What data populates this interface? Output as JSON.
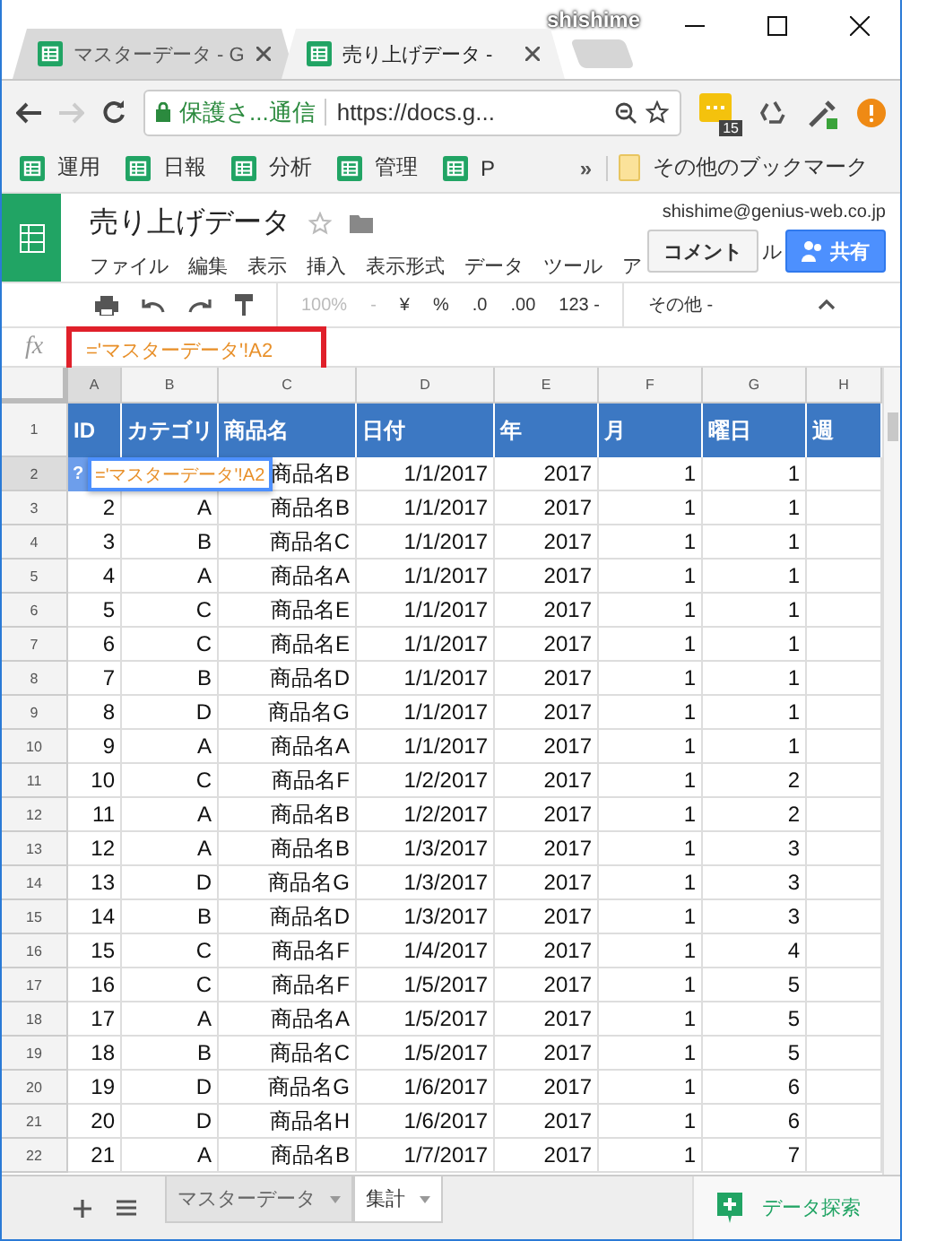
{
  "browser": {
    "profile": "shishime",
    "tabs": [
      {
        "title": "マスターデータ - G",
        "selected": false
      },
      {
        "title": "売り上げデータ -",
        "selected": true
      }
    ],
    "address": {
      "security": "保護さ...通信",
      "url": "https://docs.g..."
    },
    "extension_badge": "15",
    "bookmarks": [
      {
        "label": "運用",
        "kind": "sheet"
      },
      {
        "label": "日報",
        "kind": "sheet"
      },
      {
        "label": "分析",
        "kind": "sheet"
      },
      {
        "label": "管理",
        "kind": "sheet"
      },
      {
        "label": "P",
        "kind": "sheet"
      }
    ],
    "bookmarks_more": "»",
    "other_bookmarks": "その他のブックマーク"
  },
  "doc": {
    "title": "売り上げデータ",
    "account": "shishime@genius-web.co.jp",
    "menu": [
      "ファイル",
      "編集",
      "表示",
      "挿入",
      "表示形式",
      "データ",
      "ツール",
      "ア"
    ],
    "menu_tail": "ル",
    "comment_button": "コメント",
    "share_button": "共有"
  },
  "toolbar": {
    "zoom": "100%",
    "zoom_caret": "-",
    "items": [
      "¥",
      "%",
      ".0",
      ".00",
      "123 -"
    ],
    "more": "その他 -"
  },
  "formula_bar": {
    "label": "fx",
    "formula": "='マスターデータ'!A2"
  },
  "sheet": {
    "columns": [
      {
        "letter": "A",
        "selected": true
      },
      {
        "letter": "B",
        "selected": false
      },
      {
        "letter": "C",
        "selected": false
      },
      {
        "letter": "D",
        "selected": false
      },
      {
        "letter": "E",
        "selected": false
      },
      {
        "letter": "F",
        "selected": false
      },
      {
        "letter": "G",
        "selected": false
      },
      {
        "letter": "H",
        "selected": false
      }
    ],
    "header": {
      "number": "1",
      "cells": [
        "ID",
        "カテゴリ",
        "商品名",
        "日付",
        "年",
        "月",
        "曜日",
        "週"
      ]
    },
    "editor": {
      "hint": "?",
      "text": "='マスターデータ'!A2"
    },
    "rows": [
      {
        "number": "2",
        "selected": true,
        "product": "商品名B",
        "date": "1/1/2017",
        "year": "2017",
        "month": "1",
        "weekday": "1"
      },
      {
        "number": "3",
        "selected": false,
        "id": "2",
        "category": "A",
        "product": "商品名B",
        "date": "1/1/2017",
        "year": "2017",
        "month": "1",
        "weekday": "1"
      },
      {
        "number": "4",
        "selected": false,
        "id": "3",
        "category": "B",
        "product": "商品名C",
        "date": "1/1/2017",
        "year": "2017",
        "month": "1",
        "weekday": "1"
      },
      {
        "number": "5",
        "selected": false,
        "id": "4",
        "category": "A",
        "product": "商品名A",
        "date": "1/1/2017",
        "year": "2017",
        "month": "1",
        "weekday": "1"
      },
      {
        "number": "6",
        "selected": false,
        "id": "5",
        "category": "C",
        "product": "商品名E",
        "date": "1/1/2017",
        "year": "2017",
        "month": "1",
        "weekday": "1"
      },
      {
        "number": "7",
        "selected": false,
        "id": "6",
        "category": "C",
        "product": "商品名E",
        "date": "1/1/2017",
        "year": "2017",
        "month": "1",
        "weekday": "1"
      },
      {
        "number": "8",
        "selected": false,
        "id": "7",
        "category": "B",
        "product": "商品名D",
        "date": "1/1/2017",
        "year": "2017",
        "month": "1",
        "weekday": "1"
      },
      {
        "number": "9",
        "selected": false,
        "id": "8",
        "category": "D",
        "product": "商品名G",
        "date": "1/1/2017",
        "year": "2017",
        "month": "1",
        "weekday": "1"
      },
      {
        "number": "10",
        "selected": false,
        "id": "9",
        "category": "A",
        "product": "商品名A",
        "date": "1/1/2017",
        "year": "2017",
        "month": "1",
        "weekday": "1"
      },
      {
        "number": "11",
        "selected": false,
        "id": "10",
        "category": "C",
        "product": "商品名F",
        "date": "1/2/2017",
        "year": "2017",
        "month": "1",
        "weekday": "2"
      },
      {
        "number": "12",
        "selected": false,
        "id": "11",
        "category": "A",
        "product": "商品名B",
        "date": "1/2/2017",
        "year": "2017",
        "month": "1",
        "weekday": "2"
      },
      {
        "number": "13",
        "selected": false,
        "id": "12",
        "category": "A",
        "product": "商品名B",
        "date": "1/3/2017",
        "year": "2017",
        "month": "1",
        "weekday": "3"
      },
      {
        "number": "14",
        "selected": false,
        "id": "13",
        "category": "D",
        "product": "商品名G",
        "date": "1/3/2017",
        "year": "2017",
        "month": "1",
        "weekday": "3"
      },
      {
        "number": "15",
        "selected": false,
        "id": "14",
        "category": "B",
        "product": "商品名D",
        "date": "1/3/2017",
        "year": "2017",
        "month": "1",
        "weekday": "3"
      },
      {
        "number": "16",
        "selected": false,
        "id": "15",
        "category": "C",
        "product": "商品名F",
        "date": "1/4/2017",
        "year": "2017",
        "month": "1",
        "weekday": "4"
      },
      {
        "number": "17",
        "selected": false,
        "id": "16",
        "category": "C",
        "product": "商品名F",
        "date": "1/5/2017",
        "year": "2017",
        "month": "1",
        "weekday": "5"
      },
      {
        "number": "18",
        "selected": false,
        "id": "17",
        "category": "A",
        "product": "商品名A",
        "date": "1/5/2017",
        "year": "2017",
        "month": "1",
        "weekday": "5"
      },
      {
        "number": "19",
        "selected": false,
        "id": "18",
        "category": "B",
        "product": "商品名C",
        "date": "1/5/2017",
        "year": "2017",
        "month": "1",
        "weekday": "5"
      },
      {
        "number": "20",
        "selected": false,
        "id": "19",
        "category": "D",
        "product": "商品名G",
        "date": "1/6/2017",
        "year": "2017",
        "month": "1",
        "weekday": "6"
      },
      {
        "number": "21",
        "selected": false,
        "id": "20",
        "category": "D",
        "product": "商品名H",
        "date": "1/6/2017",
        "year": "2017",
        "month": "1",
        "weekday": "6"
      },
      {
        "number": "22",
        "selected": false,
        "id": "21",
        "category": "A",
        "product": "商品名B",
        "date": "1/7/2017",
        "year": "2017",
        "month": "1",
        "weekday": "7"
      }
    ]
  },
  "sheet_tabs": [
    {
      "label": "マスターデータ",
      "selected": false
    },
    {
      "label": "集計",
      "selected": true
    }
  ],
  "explore_button": "データ探索"
}
